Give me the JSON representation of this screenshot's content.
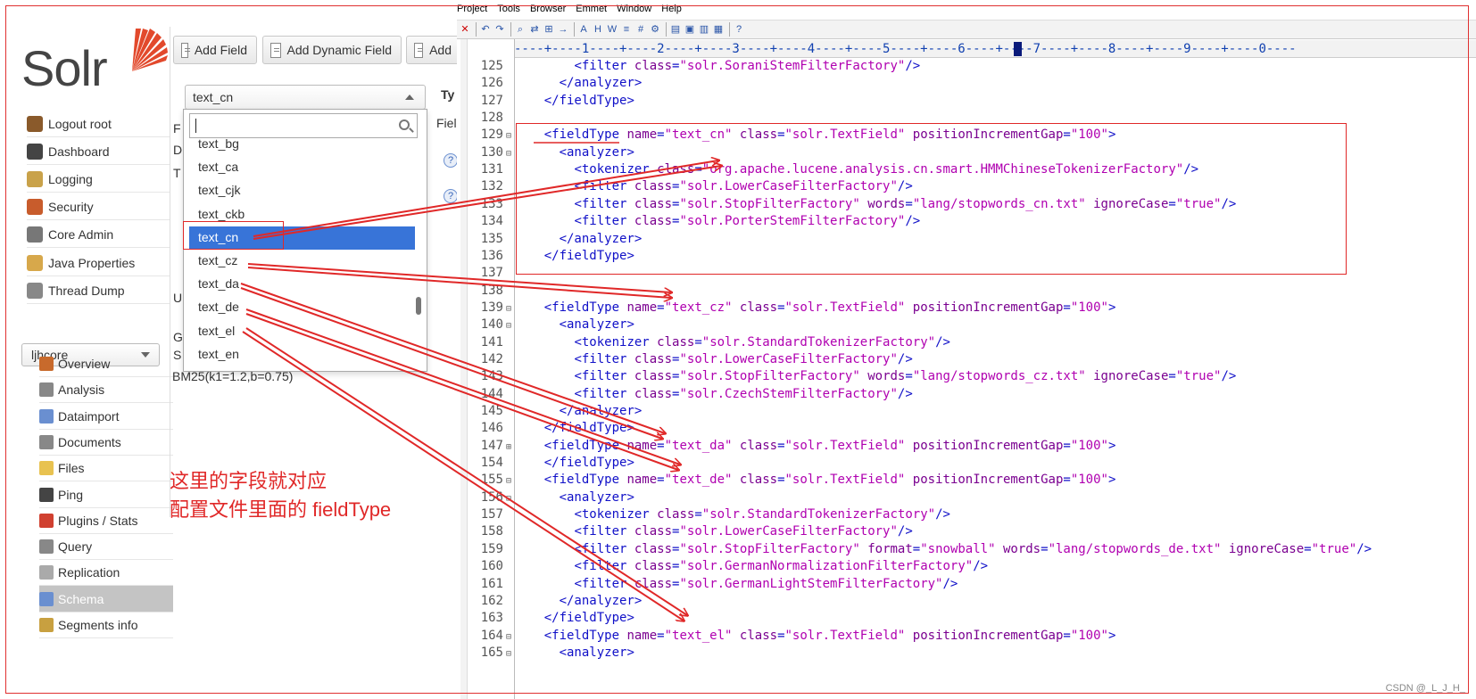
{
  "solr": {
    "logo_text": "Solr",
    "nav": [
      {
        "label": "Logout root",
        "icon": "logout-door-icon"
      },
      {
        "label": "Dashboard",
        "icon": "dashboard-gauge-icon"
      },
      {
        "label": "Logging",
        "icon": "logging-icon"
      },
      {
        "label": "Security",
        "icon": "security-users-icon"
      },
      {
        "label": "Core Admin",
        "icon": "core-admin-icon"
      },
      {
        "label": "Java Properties",
        "icon": "java-properties-icon"
      },
      {
        "label": "Thread Dump",
        "icon": "thread-dump-icon"
      }
    ],
    "core_selector": "ljhcore",
    "core_menu": [
      {
        "label": "Overview",
        "icon": "house-icon"
      },
      {
        "label": "Analysis",
        "icon": "funnel-icon"
      },
      {
        "label": "Dataimport",
        "icon": "dataimport-icon"
      },
      {
        "label": "Documents",
        "icon": "documents-icon"
      },
      {
        "label": "Files",
        "icon": "folder-icon"
      },
      {
        "label": "Ping",
        "icon": "ping-icon"
      },
      {
        "label": "Plugins / Stats",
        "icon": "plugins-icon"
      },
      {
        "label": "Query",
        "icon": "magnifier-icon"
      },
      {
        "label": "Replication",
        "icon": "replication-icon"
      },
      {
        "label": "Schema",
        "icon": "schema-icon"
      },
      {
        "label": "Segments info",
        "icon": "segments-icon"
      }
    ],
    "toolbar": {
      "add_field": "Add Field",
      "add_dynamic_field": "Add Dynamic Field",
      "add_more": "Add"
    },
    "fieldtype_select": {
      "value": "text_cn",
      "search_value": "",
      "options": [
        "text_bg",
        "text_ca",
        "text_cjk",
        "text_ckb",
        "text_cn",
        "text_cz",
        "text_da",
        "text_de",
        "text_el",
        "text_en"
      ],
      "selected": "text_cn"
    },
    "meta_labels": {
      "ty": "Ty",
      "fiel": "Fiel",
      "f": "F",
      "d": "D",
      "t": "T",
      "u": "U",
      "g": "G",
      "s": "S",
      "similarity": "BM25(k1=1.2,b=0.75)"
    },
    "annotation": {
      "line1": "这里的字段就对应",
      "line2": "配置文件里面的 fieldType"
    }
  },
  "editor": {
    "menu": [
      "Project",
      "Tools",
      "Browser",
      "Emmet",
      "Window",
      "Help"
    ],
    "ruler": "----+----1----+----2----+----3----+----4----+----5----+----6----+----7----+----8----+----9----+----0----",
    "lines": [
      {
        "n": "125",
        "fold": "",
        "code": "      <filter class=\"solr.SoraniStemFilterFactory\"/>"
      },
      {
        "n": "126",
        "fold": "",
        "code": "    </analyzer>"
      },
      {
        "n": "127",
        "fold": "",
        "code": "  </fieldType>"
      },
      {
        "n": "128",
        "fold": "",
        "code": ""
      },
      {
        "n": "129",
        "fold": "⊟",
        "code": "  <fieldType name=\"text_cn\" class=\"solr.TextField\" positionIncrementGap=\"100\">"
      },
      {
        "n": "130",
        "fold": "⊟",
        "code": "    <analyzer>"
      },
      {
        "n": "131",
        "fold": "",
        "code": "      <tokenizer class=\"org.apache.lucene.analysis.cn.smart.HMMChineseTokenizerFactory\"/>"
      },
      {
        "n": "132",
        "fold": "",
        "code": "      <filter class=\"solr.LowerCaseFilterFactory\"/>"
      },
      {
        "n": "133",
        "fold": "",
        "code": "      <filter class=\"solr.StopFilterFactory\" words=\"lang/stopwords_cn.txt\" ignoreCase=\"true\"/>"
      },
      {
        "n": "134",
        "fold": "",
        "code": "      <filter class=\"solr.PorterStemFilterFactory\"/>"
      },
      {
        "n": "135",
        "fold": "",
        "code": "    </analyzer>"
      },
      {
        "n": "136",
        "fold": "",
        "code": "  </fieldType>"
      },
      {
        "n": "137",
        "fold": "",
        "code": ""
      },
      {
        "n": "138",
        "fold": "",
        "code": ""
      },
      {
        "n": "139",
        "fold": "⊟",
        "code": "  <fieldType name=\"text_cz\" class=\"solr.TextField\" positionIncrementGap=\"100\">"
      },
      {
        "n": "140",
        "fold": "⊟",
        "code": "    <analyzer>"
      },
      {
        "n": "141",
        "fold": "",
        "code": "      <tokenizer class=\"solr.StandardTokenizerFactory\"/>"
      },
      {
        "n": "142",
        "fold": "",
        "code": "      <filter class=\"solr.LowerCaseFilterFactory\"/>"
      },
      {
        "n": "143",
        "fold": "",
        "code": "      <filter class=\"solr.StopFilterFactory\" words=\"lang/stopwords_cz.txt\" ignoreCase=\"true\"/>"
      },
      {
        "n": "144",
        "fold": "",
        "code": "      <filter class=\"solr.CzechStemFilterFactory\"/>"
      },
      {
        "n": "145",
        "fold": "",
        "code": "    </analyzer>"
      },
      {
        "n": "146",
        "fold": "",
        "code": "  </fieldType>"
      },
      {
        "n": "147",
        "fold": "⊞",
        "code": "  <fieldType name=\"text_da\" class=\"solr.TextField\" positionIncrementGap=\"100\">"
      },
      {
        "n": "154",
        "fold": "",
        "code": "  </fieldType>"
      },
      {
        "n": "155",
        "fold": "⊟",
        "code": "  <fieldType name=\"text_de\" class=\"solr.TextField\" positionIncrementGap=\"100\">"
      },
      {
        "n": "156",
        "fold": "⊟",
        "code": "    <analyzer>"
      },
      {
        "n": "157",
        "fold": "",
        "code": "      <tokenizer class=\"solr.StandardTokenizerFactory\"/>"
      },
      {
        "n": "158",
        "fold": "",
        "code": "      <filter class=\"solr.LowerCaseFilterFactory\"/>"
      },
      {
        "n": "159",
        "fold": "",
        "code": "      <filter class=\"solr.StopFilterFactory\" format=\"snowball\" words=\"lang/stopwords_de.txt\" ignoreCase=\"true\"/>"
      },
      {
        "n": "160",
        "fold": "",
        "code": "      <filter class=\"solr.GermanNormalizationFilterFactory\"/>"
      },
      {
        "n": "161",
        "fold": "",
        "code": "      <filter class=\"solr.GermanLightStemFilterFactory\"/>"
      },
      {
        "n": "162",
        "fold": "",
        "code": "    </analyzer>"
      },
      {
        "n": "163",
        "fold": "",
        "code": "  </fieldType>"
      },
      {
        "n": "164",
        "fold": "⊟",
        "code": "  <fieldType name=\"text_el\" class=\"solr.TextField\" positionIncrementGap=\"100\">"
      },
      {
        "n": "165",
        "fold": "⊟",
        "code": "    <analyzer>"
      }
    ]
  },
  "colors": {
    "annotation_red": "#e02828",
    "selected_blue": "#3874d8",
    "tag_blue": "#1010c8",
    "attr_purple": "#7a0090",
    "value_magenta": "#b000b0"
  },
  "watermark": "CSDN @_L_J_H_"
}
